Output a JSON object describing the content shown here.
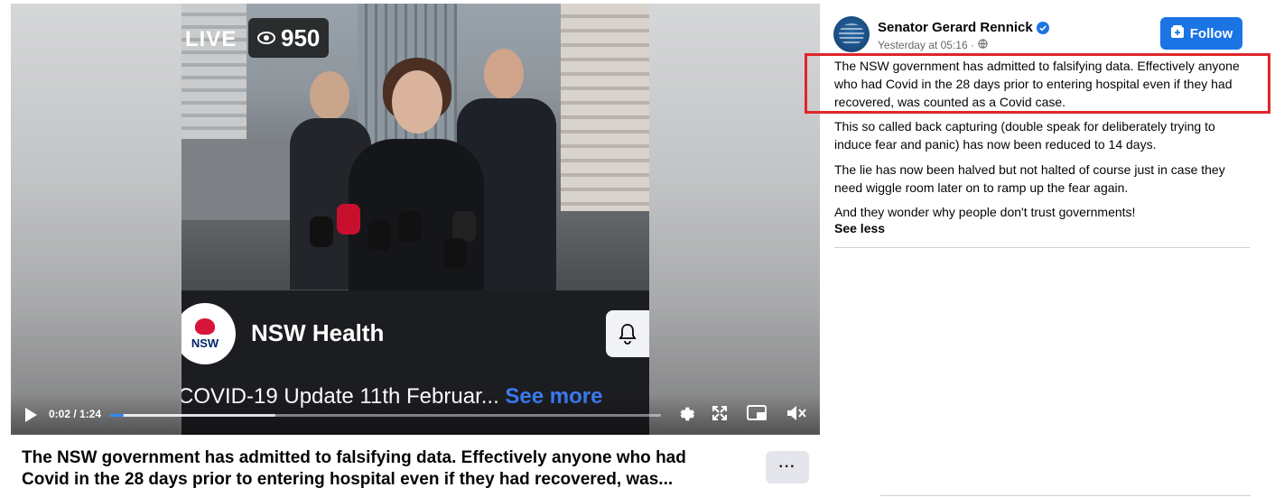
{
  "video": {
    "live_label": "LIVE",
    "viewer_count": "950",
    "page_name": "NSW Health",
    "logo_text": "NSW",
    "update_text": "COVID-19 Update 11th Februar...",
    "see_more": "See more",
    "time_display": "0:02 / 1:24",
    "progress": {
      "current_seconds": 2,
      "total_seconds": 84,
      "buffered_fraction": 0.3
    }
  },
  "caption": {
    "text": "The NSW government has admitted to falsifying data. Effectively anyone who had Covid in the 28 days prior to entering hospital even if they had recovered, was...",
    "more_label": "···"
  },
  "post": {
    "author": "Senator Gerard Rennick",
    "timestamp": "Yesterday at 05:16 ·",
    "follow_label": "Follow",
    "paragraphs": [
      "The NSW government has admitted to falsifying data. Effectively anyone who had Covid in the 28 days prior to entering hospital even if they had recovered, was counted as a Covid case.",
      "This so called back capturing (double speak for deliberately trying to induce fear and panic) has now been reduced to 14 days.",
      "The lie has now been halved but not halted of course just in case they need wiggle room later on to ramp up the fear again.",
      "And they wonder why people don't trust governments!"
    ],
    "see_less": "See less"
  },
  "colors": {
    "follow_button": "#1b74e4",
    "highlight_box": "#e0252a",
    "progress_played": "#2d88ff",
    "see_more_link": "#3a7bf0"
  },
  "icons": [
    "eye-icon",
    "bell-icon",
    "play-icon",
    "settings-icon",
    "fullscreen-icon",
    "pip-icon",
    "volume-muted-icon",
    "verified-icon",
    "globe-icon",
    "follow-plus-icon",
    "nsw-waratah-icon"
  ]
}
